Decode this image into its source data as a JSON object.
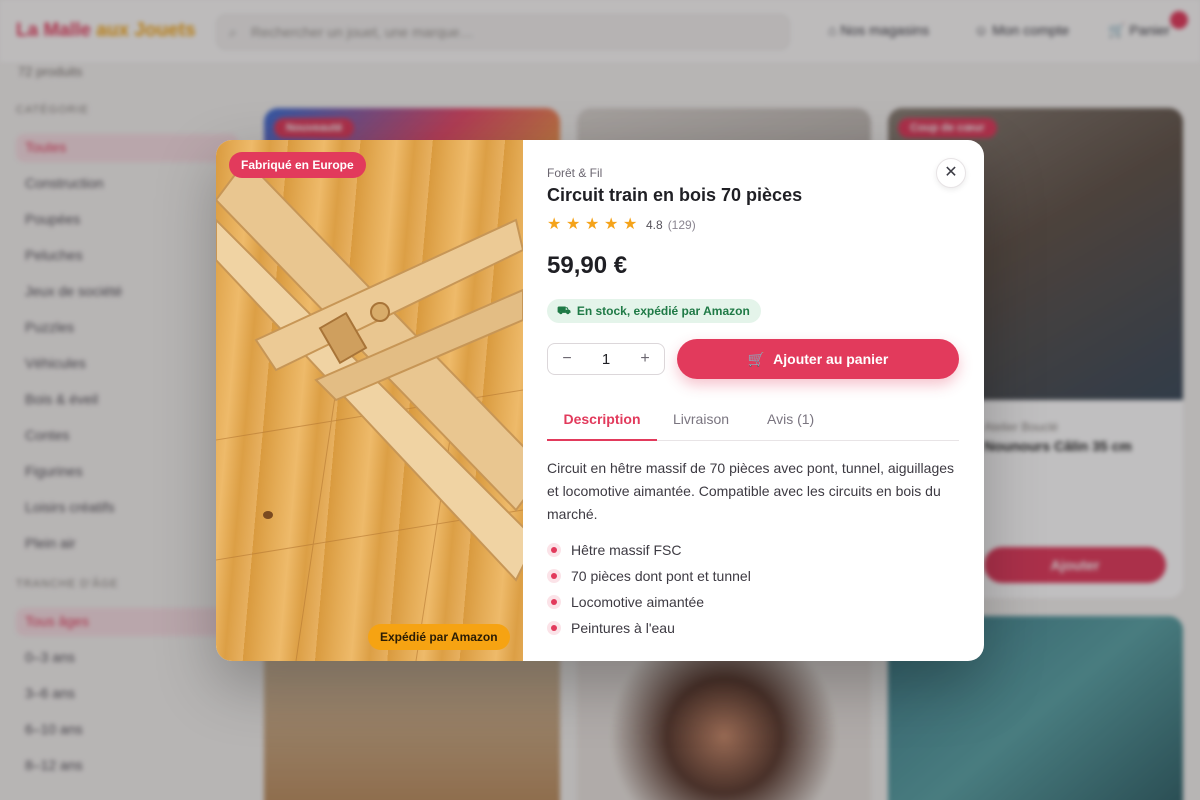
{
  "background": {
    "logo": {
      "part1": "La Malle ",
      "part2": "aux Jouets"
    },
    "search_placeholder": "Rechercher un jouet, une marque…",
    "nav": {
      "stores": "Nos magasins",
      "account": "Mon compte",
      "cart": "Panier"
    },
    "product_count": "72 produits",
    "sidebar": {
      "category_heading": "CATÉGORIE",
      "categories": [
        "Toutes",
        "Construction",
        "Poupées",
        "Peluches",
        "Jeux de société",
        "Puzzles",
        "Véhicules",
        "Bois & éveil",
        "Contes",
        "Figurines",
        "Loisirs créatifs",
        "Plein air"
      ],
      "age_heading": "TRANCHE D'ÂGE",
      "ages": [
        "Tous âges",
        "0–3 ans",
        "3–6 ans",
        "6–10 ans",
        "8–12 ans"
      ]
    },
    "cards": [
      {
        "tag": "Nouveauté"
      },
      {},
      {
        "tag": "Coup de cœur",
        "brand": "Atelier Bouclé",
        "name": "Nounours Câlin 35 cm",
        "add": "Ajouter"
      }
    ]
  },
  "modal": {
    "badge_origin": "Fabriqué en Europe",
    "badge_shipping": "Expédié par Amazon",
    "brand": "Forêt & Fil",
    "title": "Circuit train en bois 70 pièces",
    "rating": "4.8",
    "review_count": "(129)",
    "price": "59,90 €",
    "stock": "En stock, expédié par Amazon",
    "quantity": "1",
    "add_to_cart": "Ajouter au panier",
    "tabs": [
      "Description",
      "Livraison",
      "Avis (1)"
    ],
    "description": "Circuit en hêtre massif de 70 pièces avec pont, tunnel, aiguillages et locomotive aimantée. Compatible avec les circuits en bois du marché.",
    "features": [
      "Hêtre massif FSC",
      "70 pièces dont pont et tunnel",
      "Locomotive aimantée",
      "Peintures à l'eau"
    ],
    "icons": {
      "close": "close-icon",
      "star": "star-icon",
      "truck": "truck-icon",
      "cart": "cart-icon",
      "minus": "minus-icon",
      "plus": "plus-icon"
    },
    "colors": {
      "accent": "#e23a5c",
      "amber": "#f6a312",
      "stock_green": "#1f7a46"
    }
  }
}
